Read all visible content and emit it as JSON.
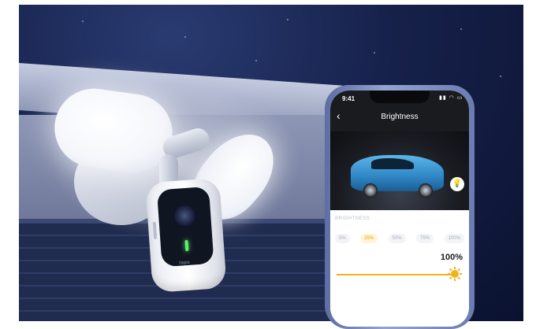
{
  "camera": {
    "brand": "tapo"
  },
  "phone": {
    "status": {
      "time": "9:41",
      "icons": "▮▮ ◠ ▭"
    },
    "header": {
      "back_icon": "chevron-left-icon",
      "title": "Brightness"
    },
    "preview": {
      "action_icon": "light-bulb-icon"
    },
    "brightness": {
      "section_label": "BRIGHTNESS",
      "options": [
        "5%",
        "25%",
        "50%",
        "75%",
        "100%"
      ],
      "selected_option": "25%",
      "current_value": "100%",
      "slider_level": 1.0
    }
  },
  "colors": {
    "accent": "#f1b21a",
    "selected_text": "#e4a400",
    "header_bg": "#1a1b1f"
  }
}
